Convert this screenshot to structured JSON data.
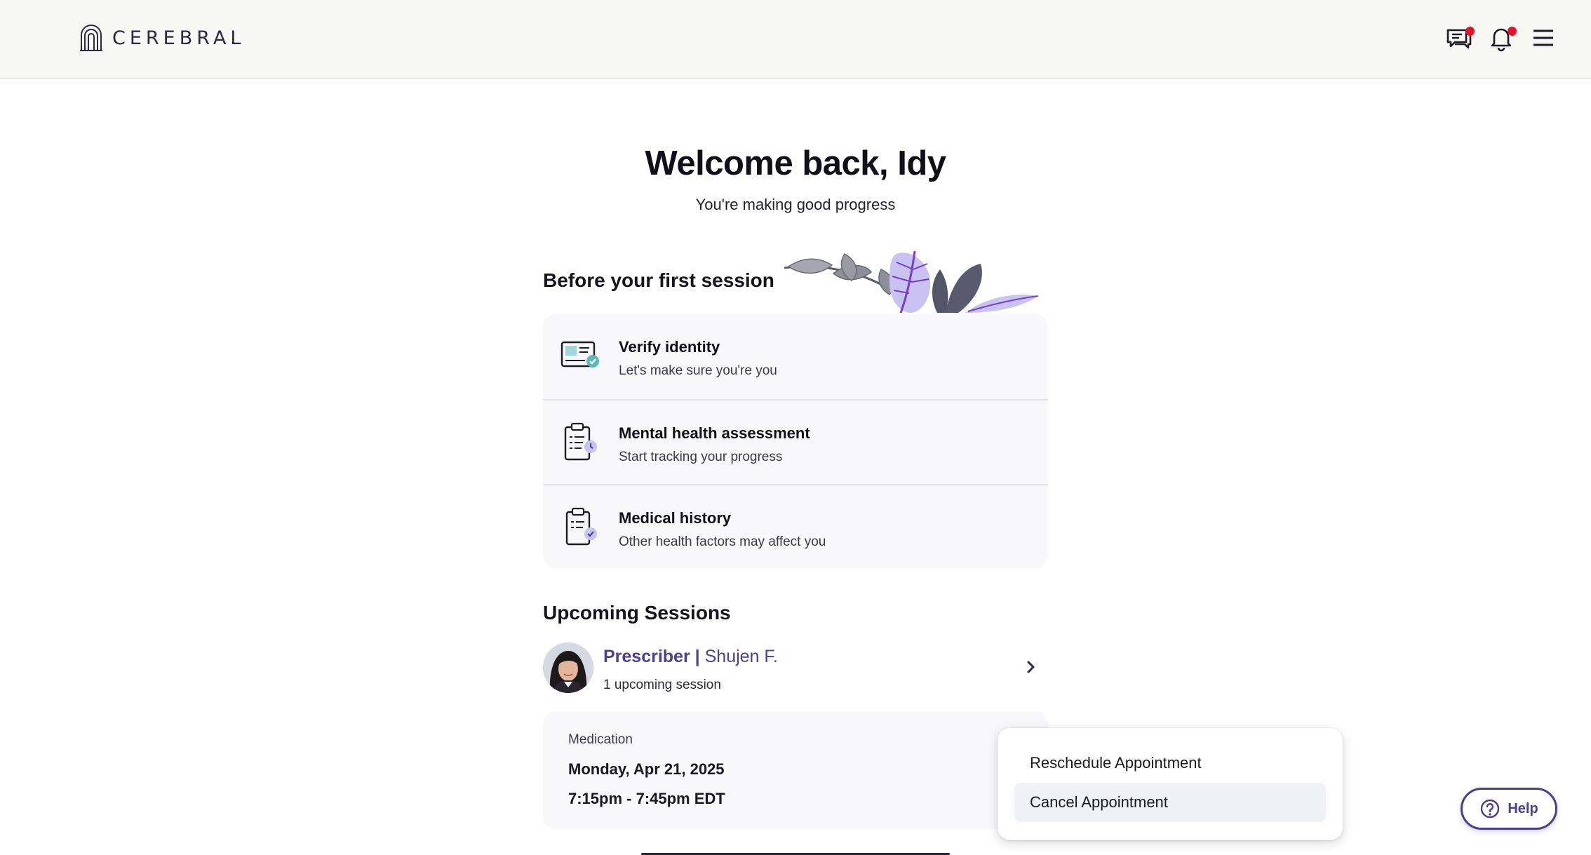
{
  "header": {
    "brand": "CEREBRAL",
    "icons": [
      "chat-icon",
      "bell-icon",
      "menu-icon"
    ],
    "badge_color": "#e3132b",
    "background": "#f7f7f3"
  },
  "welcome": {
    "title": "Welcome back, Idy",
    "subtitle": "You're making good progress"
  },
  "tasks": {
    "section_title": "Before your first session",
    "items": [
      {
        "title": "Verify identity",
        "description": "Let's make sure you're you",
        "icon": "id-card-icon"
      },
      {
        "title": "Mental health assessment",
        "description": "Start tracking your progress",
        "icon": "clipboard-clock-icon"
      },
      {
        "title": "Medical history",
        "description": "Other health factors may affect you",
        "icon": "clipboard-check-icon"
      }
    ]
  },
  "upcoming": {
    "section_title": "Upcoming Sessions",
    "provider_role": "Prescriber",
    "separator": "|",
    "provider_name": "Shujen F.",
    "session_count": "1 upcoming session",
    "appointment": {
      "type": "Medication",
      "date": "Monday, Apr 21, 2025",
      "time": "7:15pm - 7:45pm EDT"
    }
  },
  "appointment_menu": {
    "items": [
      "Reschedule Appointment",
      "Cancel Appointment"
    ],
    "highlighted": "Cancel Appointment"
  },
  "help": {
    "label": "Help"
  },
  "colors": {
    "accent": "#4a3f8c",
    "provider_text": "#4e3f91",
    "card_bg": "#f8f8fa"
  }
}
